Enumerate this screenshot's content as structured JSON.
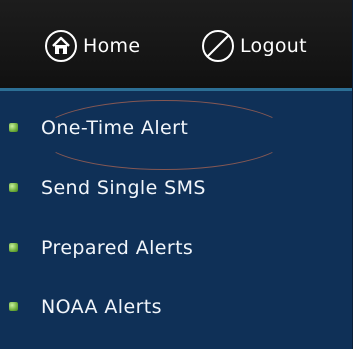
{
  "header": {
    "home": {
      "label": "Home",
      "icon": "home-icon"
    },
    "logout": {
      "label": "Logout",
      "icon": "logout-icon"
    }
  },
  "menu": {
    "items": [
      {
        "label": "One-Time Alert",
        "icon": "bullet-icon"
      },
      {
        "label": "Send Single SMS",
        "icon": "bullet-icon"
      },
      {
        "label": "Prepared Alerts",
        "icon": "bullet-icon"
      },
      {
        "label": "NOAA Alerts",
        "icon": "bullet-icon"
      }
    ]
  },
  "colors": {
    "topbar": "#111111",
    "menu_background": "#0f3057",
    "bullet": "#6fae3c",
    "text": "#ffffff"
  }
}
